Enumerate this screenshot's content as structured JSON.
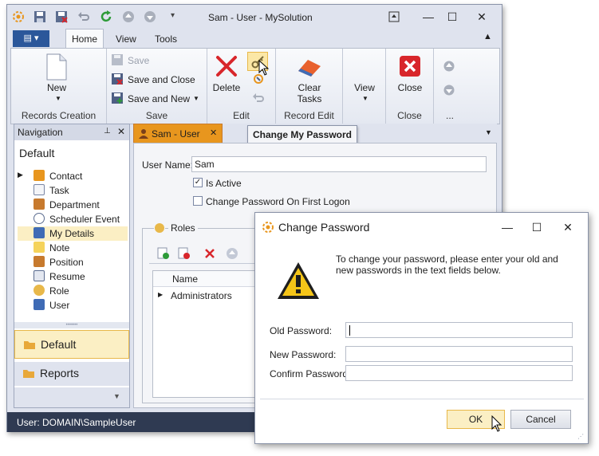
{
  "window": {
    "title": "Sam - User - MySolution",
    "status_text": "User: DOMAIN\\SampleUser"
  },
  "ribbon": {
    "tabs": [
      "Home",
      "View",
      "Tools"
    ],
    "active_tab": "Home",
    "groups": {
      "records_creation": "Records Creation",
      "save": "Save",
      "edit": "Edit",
      "record_edit": "Record Edit",
      "close": "Close",
      "more": "..."
    },
    "buttons": {
      "new": "New",
      "save": "Save",
      "save_and_close": "Save and Close",
      "save_and_new": "Save and New",
      "delete": "Delete",
      "clear_tasks_1": "Clear",
      "clear_tasks_2": "Tasks",
      "view": "View",
      "close": "Close"
    },
    "tooltip": "Change My Password"
  },
  "navigation": {
    "header": "Navigation",
    "group_title": "Default",
    "items": [
      {
        "label": "Contact",
        "icon": "contact-icon"
      },
      {
        "label": "Task",
        "icon": "task-icon"
      },
      {
        "label": "Department",
        "icon": "department-icon"
      },
      {
        "label": "Scheduler Event",
        "icon": "scheduler-icon"
      },
      {
        "label": "My Details",
        "icon": "my-details-icon"
      },
      {
        "label": "Note",
        "icon": "note-icon"
      },
      {
        "label": "Position",
        "icon": "position-icon"
      },
      {
        "label": "Resume",
        "icon": "resume-icon"
      },
      {
        "label": "Role",
        "icon": "role-icon"
      },
      {
        "label": "User",
        "icon": "user-icon"
      }
    ],
    "selected_item": "My Details",
    "groups": [
      "Default",
      "Reports"
    ]
  },
  "document": {
    "tab_title": "Sam - User",
    "user_name_label": "User Name:",
    "user_name_value": "Sam",
    "is_active_label": "Is Active",
    "is_active_checked": true,
    "change_password_label": "Change Password On First Logon",
    "change_password_checked": false,
    "roles_label": "Roles",
    "roles_column": "Name",
    "roles_rows": [
      "Administrators"
    ]
  },
  "dialog": {
    "title": "Change Password",
    "message": "To change your password, please enter your old and new passwords in the text fields below.",
    "old_password_label": "Old Password:",
    "new_password_label": "New Password:",
    "confirm_password_label": "Confirm Password:",
    "ok_label": "OK",
    "cancel_label": "Cancel"
  },
  "colors": {
    "accent_orange": "#e8961e",
    "selected_bg": "#fbefc4",
    "status_bar": "#2f3a52",
    "file_button": "#2b579a"
  }
}
